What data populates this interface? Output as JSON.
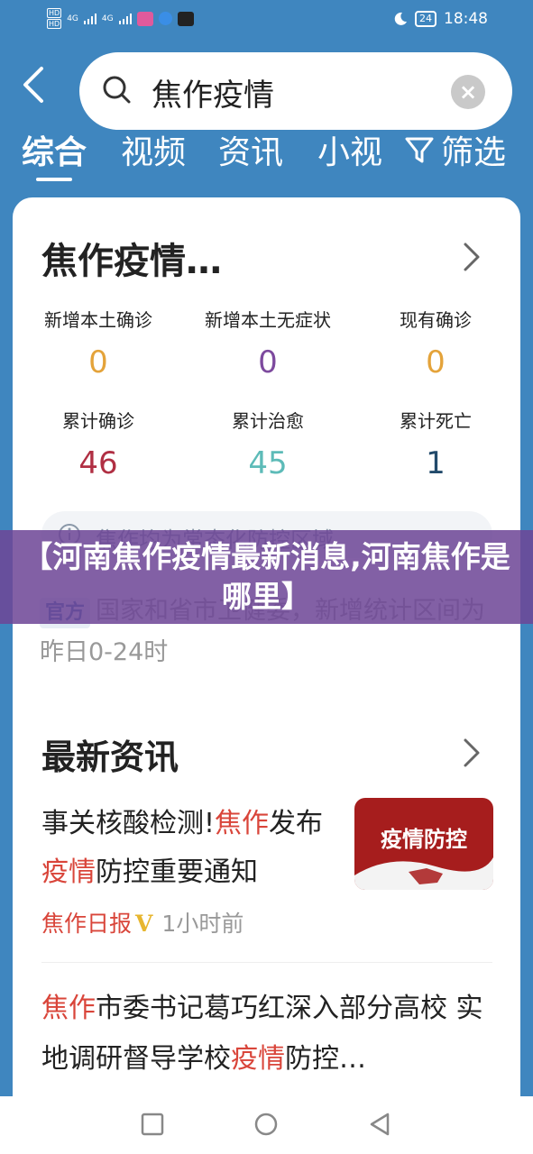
{
  "status_bar": {
    "left_badges": [
      "HD",
      "HD"
    ],
    "signal_left": "4G",
    "signal_right": "4G",
    "apps": [
      "app-pink-icon",
      "app-blue-icon",
      "tiktok-icon"
    ],
    "battery": "24",
    "time": "18:48"
  },
  "search": {
    "query": "焦作疫情"
  },
  "tabs": [
    {
      "label": "综合",
      "active": true
    },
    {
      "label": "视频",
      "active": false
    },
    {
      "label": "资讯",
      "active": false
    },
    {
      "label": "小视",
      "active": false
    }
  ],
  "filter_label": "筛选",
  "card": {
    "title": "焦作疫情…",
    "stats": [
      {
        "label": "新增本土确诊",
        "value": "0",
        "color": "#e4a33a"
      },
      {
        "label": "新增本土无症状",
        "value": "0",
        "color": "#7d4a9e"
      },
      {
        "label": "现有确诊",
        "value": "0",
        "color": "#e4a33a"
      },
      {
        "label": "累计确诊",
        "value": "46",
        "color": "#b02f43"
      },
      {
        "label": "累计治愈",
        "value": "45",
        "color": "#5dbbb8"
      },
      {
        "label": "累计死亡",
        "value": "1",
        "color": "#224a6b"
      }
    ],
    "notice_text": "焦作均为常态化防控区域",
    "official_badge": "官方",
    "official_text": "国家和省市卫健委，新增统计区间为昨日0-24时"
  },
  "news_section": {
    "title": "最新资讯",
    "item1": {
      "parts": [
        "事关核酸检测!",
        "焦作",
        "发布",
        "疫情",
        "防控重要通知"
      ],
      "source": "焦作日报",
      "verified": "V",
      "time": "1小时前",
      "thumb_text": "疫情防控"
    },
    "item2": {
      "parts": [
        "焦作",
        "市委书记葛巧红深入部分高校 实地调研督导学校",
        "疫情",
        "防控…"
      ]
    }
  },
  "overlay": {
    "text": "【河南焦作疫情最新消息,河南焦作是哪里】"
  }
}
